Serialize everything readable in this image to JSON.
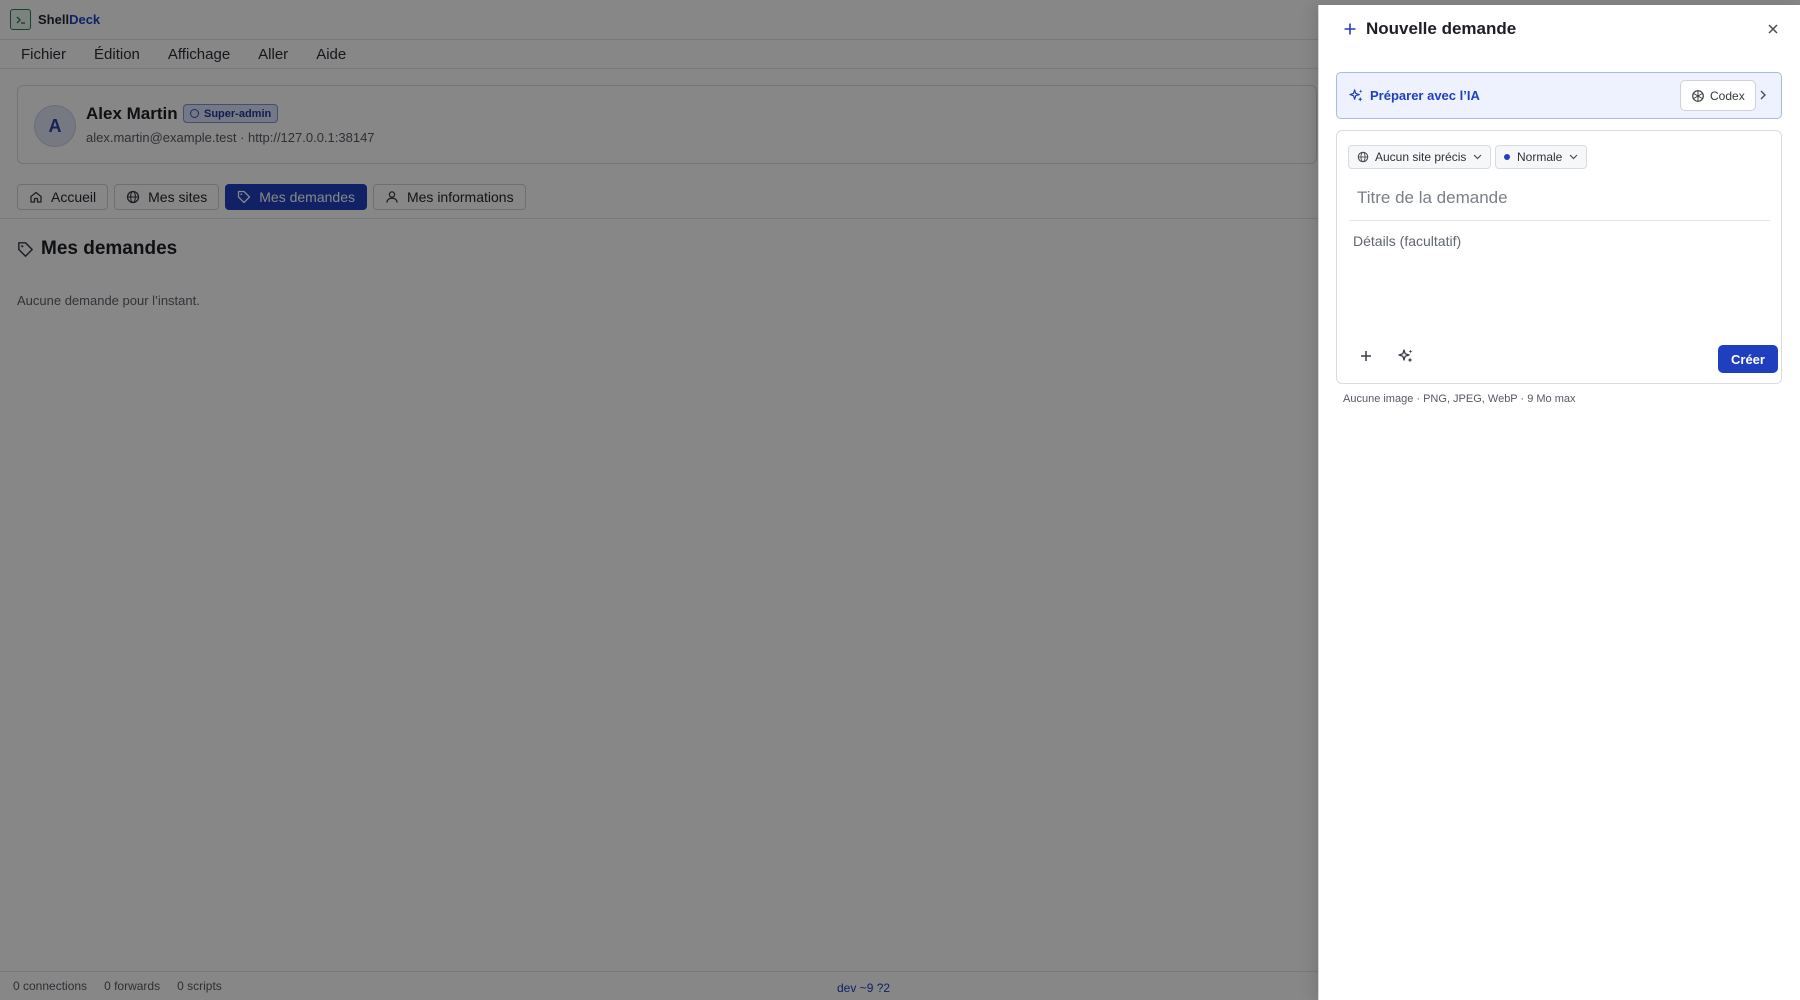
{
  "app": {
    "name_part1": "Shell",
    "name_part2": "Deck",
    "logo_icon": "terminal-icon"
  },
  "menu": {
    "items": [
      "Fichier",
      "Édition",
      "Affichage",
      "Aller",
      "Aide"
    ]
  },
  "profile": {
    "avatar_initial": "A",
    "name": "Alex Martin",
    "role_badge": "Super-admin",
    "meta": "alex.martin@example.test · http://127.0.0.1:38147"
  },
  "tabs": [
    {
      "label": "Accueil",
      "icon": "home-icon",
      "active": false
    },
    {
      "label": "Mes sites",
      "icon": "globe-icon",
      "active": false
    },
    {
      "label": "Mes demandes",
      "icon": "tag-icon",
      "active": true
    },
    {
      "label": "Mes informations",
      "icon": "user-icon",
      "active": false
    }
  ],
  "main": {
    "section_title": "Mes demandes",
    "empty_state": "Aucune demande pour l’instant."
  },
  "status": {
    "connections": "0 connections",
    "forwards": "0 forwards",
    "scripts": "0 scripts",
    "branch": "dev ~9 ?2"
  },
  "drawer": {
    "title": "Nouvelle demande",
    "ai_label": "Préparer avec l’IA",
    "ai_provider": "Codex",
    "site_chip": "Aucun site précis",
    "priority_chip": "Normale",
    "title_placeholder": "Titre de la demande",
    "details_placeholder": "Détails (facultatif)",
    "create_label": "Créer",
    "image_hint": "Aucune image · PNG, JPEG, WebP · 9 Mo max"
  },
  "colors": {
    "accent": "#1f3fbf",
    "overlay": "rgba(0,0,0,0.47)",
    "ai_bar_bg": "#eef2fe"
  }
}
